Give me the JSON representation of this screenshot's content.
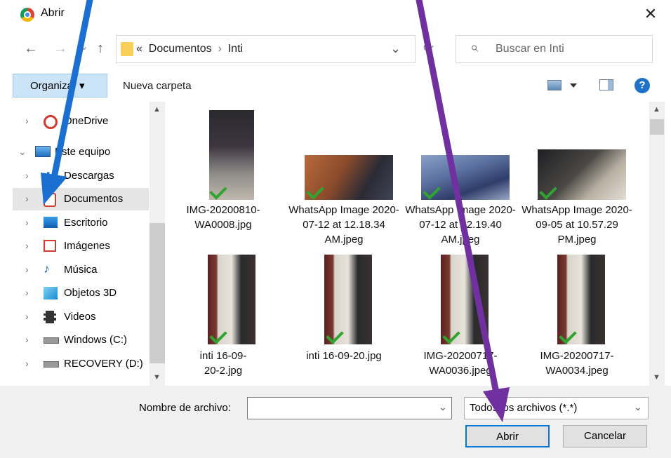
{
  "window": {
    "title": "Abrir",
    "close_label": "✕"
  },
  "nav_buttons": {
    "back": "←",
    "forward": "→",
    "recent": "⌄",
    "up": "↑"
  },
  "address": {
    "prefix": "«",
    "crumb1": "Documentos",
    "sep": "›",
    "crumb2": "Inti",
    "dropdown": "⌄",
    "refresh": "⟳"
  },
  "search": {
    "placeholder": "Buscar en Inti",
    "icon": "⌕"
  },
  "toolbar": {
    "organize_label": "Organizar ▾",
    "new_folder_label": "Nueva carpeta",
    "help": "?"
  },
  "sidebar": {
    "items": [
      {
        "label": "OneDrive",
        "chevron": "›",
        "icon": "onedrive-icon"
      },
      {
        "label": "Este equipo",
        "chevron": "⌄",
        "icon": "pc-icon"
      },
      {
        "label": "Descargas",
        "chevron": "›",
        "icon": "download-icon"
      },
      {
        "label": "Documentos",
        "chevron": "›",
        "icon": "documents-icon"
      },
      {
        "label": "Escritorio",
        "chevron": "›",
        "icon": "desktop-icon"
      },
      {
        "label": "Imágenes",
        "chevron": "›",
        "icon": "pictures-icon"
      },
      {
        "label": "Música",
        "chevron": "›",
        "icon": "music-icon"
      },
      {
        "label": "Objetos 3D",
        "chevron": "›",
        "icon": "objects3d-icon"
      },
      {
        "label": "Videos",
        "chevron": "›",
        "icon": "videos-icon"
      },
      {
        "label": "Windows (C:)",
        "chevron": "›",
        "icon": "drive-icon"
      },
      {
        "label": "RECOVERY (D:)",
        "chevron": "›",
        "icon": "drive-icon"
      }
    ]
  },
  "files": [
    {
      "name": "IMG-20200810-WA0008.jpg"
    },
    {
      "name": "WhatsApp Image 2020-07-12 at 12.18.34 AM.jpeg"
    },
    {
      "name": "WhatsApp Image 2020-07-12 at 12.19.40 AM.jpeg"
    },
    {
      "name": "WhatsApp Image 2020-09-05 at 10.57.29 PM.jpeg"
    },
    {
      "name": "inti 16-09-20-2.jpg"
    },
    {
      "name": "inti 16-09-20.jpg"
    },
    {
      "name": "IMG-20200717-WA0036.jpeg"
    },
    {
      "name": "IMG-20200717-WA0034.jpeg"
    }
  ],
  "footer": {
    "filename_label": "Nombre de archivo:",
    "filename_value": "",
    "filter_value": "Todos los archivos (*.*)",
    "open_label": "Abrir",
    "cancel_label": "Cancelar"
  },
  "colors": {
    "accent": "#0078d7",
    "annotation_blue": "#1a6fd1",
    "annotation_purple": "#7030a0",
    "check_green": "#2fa52f"
  }
}
